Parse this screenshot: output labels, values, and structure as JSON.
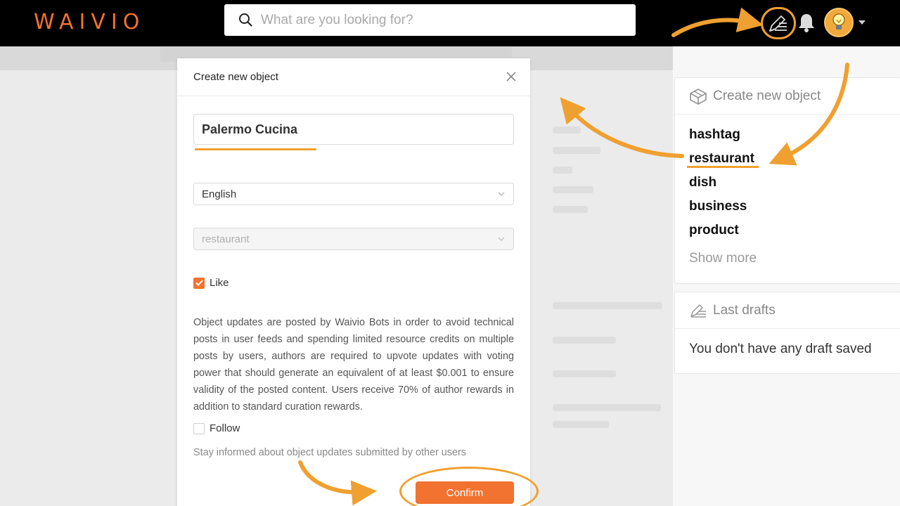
{
  "header": {
    "logo": "WAIVIO",
    "search_placeholder": "What are you looking for?"
  },
  "modal": {
    "title": "Create new object",
    "name_value": "Palermo Cucina",
    "language": "English",
    "object_type": "restaurant",
    "like_label": "Like",
    "like_checked": true,
    "notice": "Object updates are posted by Waivio Bots in order to avoid technical posts in user feeds and spending limited resource credits on multiple posts by users, authors are required to upvote updates with voting power that should generate an equivalent of at least $0.001 to ensure validity of the posted content. Users receive 70% of author rewards in addition to standard curation rewards.",
    "follow_label": "Follow",
    "follow_checked": false,
    "follow_hint": "Stay informed about object updates submitted by other users",
    "confirm_label": "Confirm"
  },
  "sidebar": {
    "create_title": "Create new object",
    "object_types": [
      "hashtag",
      "restaurant",
      "dish",
      "business",
      "product"
    ],
    "show_more": "Show more",
    "drafts_title": "Last drafts",
    "drafts_empty": "You don't have any draft saved"
  },
  "colors": {
    "accent": "#f2722f",
    "annotation": "#f0a030",
    "header_bg": "#000000"
  }
}
